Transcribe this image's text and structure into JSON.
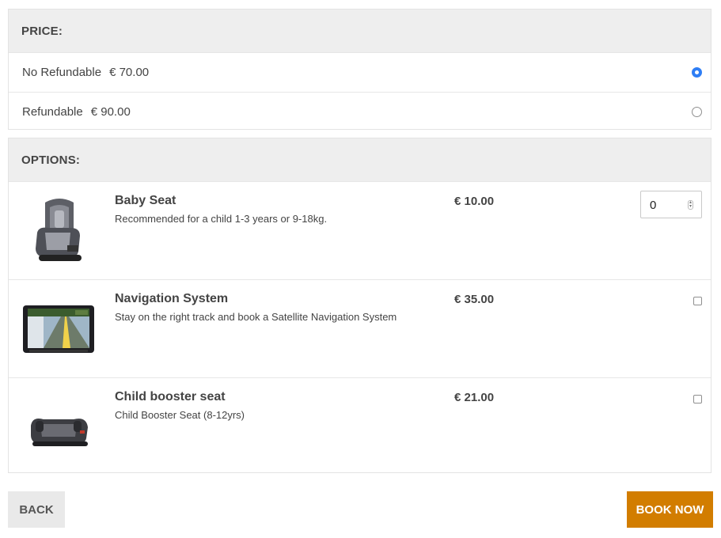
{
  "price": {
    "header": "PRICE:",
    "options": [
      {
        "label": "No Refundable",
        "amount": "€ 70.00",
        "selected": true
      },
      {
        "label": "Refundable",
        "amount": "€ 90.00",
        "selected": false
      }
    ]
  },
  "options": {
    "header": "OPTIONS:",
    "items": [
      {
        "title": "Baby Seat",
        "desc": "Recommended for a child 1-3 years or 9-18kg.",
        "price": "€ 10.00",
        "quantity": "0"
      },
      {
        "title": "Navigation System",
        "desc": "Stay on the right track and book a Satellite Navigation System",
        "price": "€ 35.00",
        "checked": false
      },
      {
        "title": "Child booster seat",
        "desc": "Child Booster Seat (8-12yrs)",
        "price": "€ 21.00",
        "checked": false
      }
    ]
  },
  "actions": {
    "back": "BACK",
    "book": "BOOK NOW"
  },
  "colors": {
    "accent": "#d27d00",
    "radio": "#2f7ef5",
    "header_bg": "#eeeeee"
  }
}
